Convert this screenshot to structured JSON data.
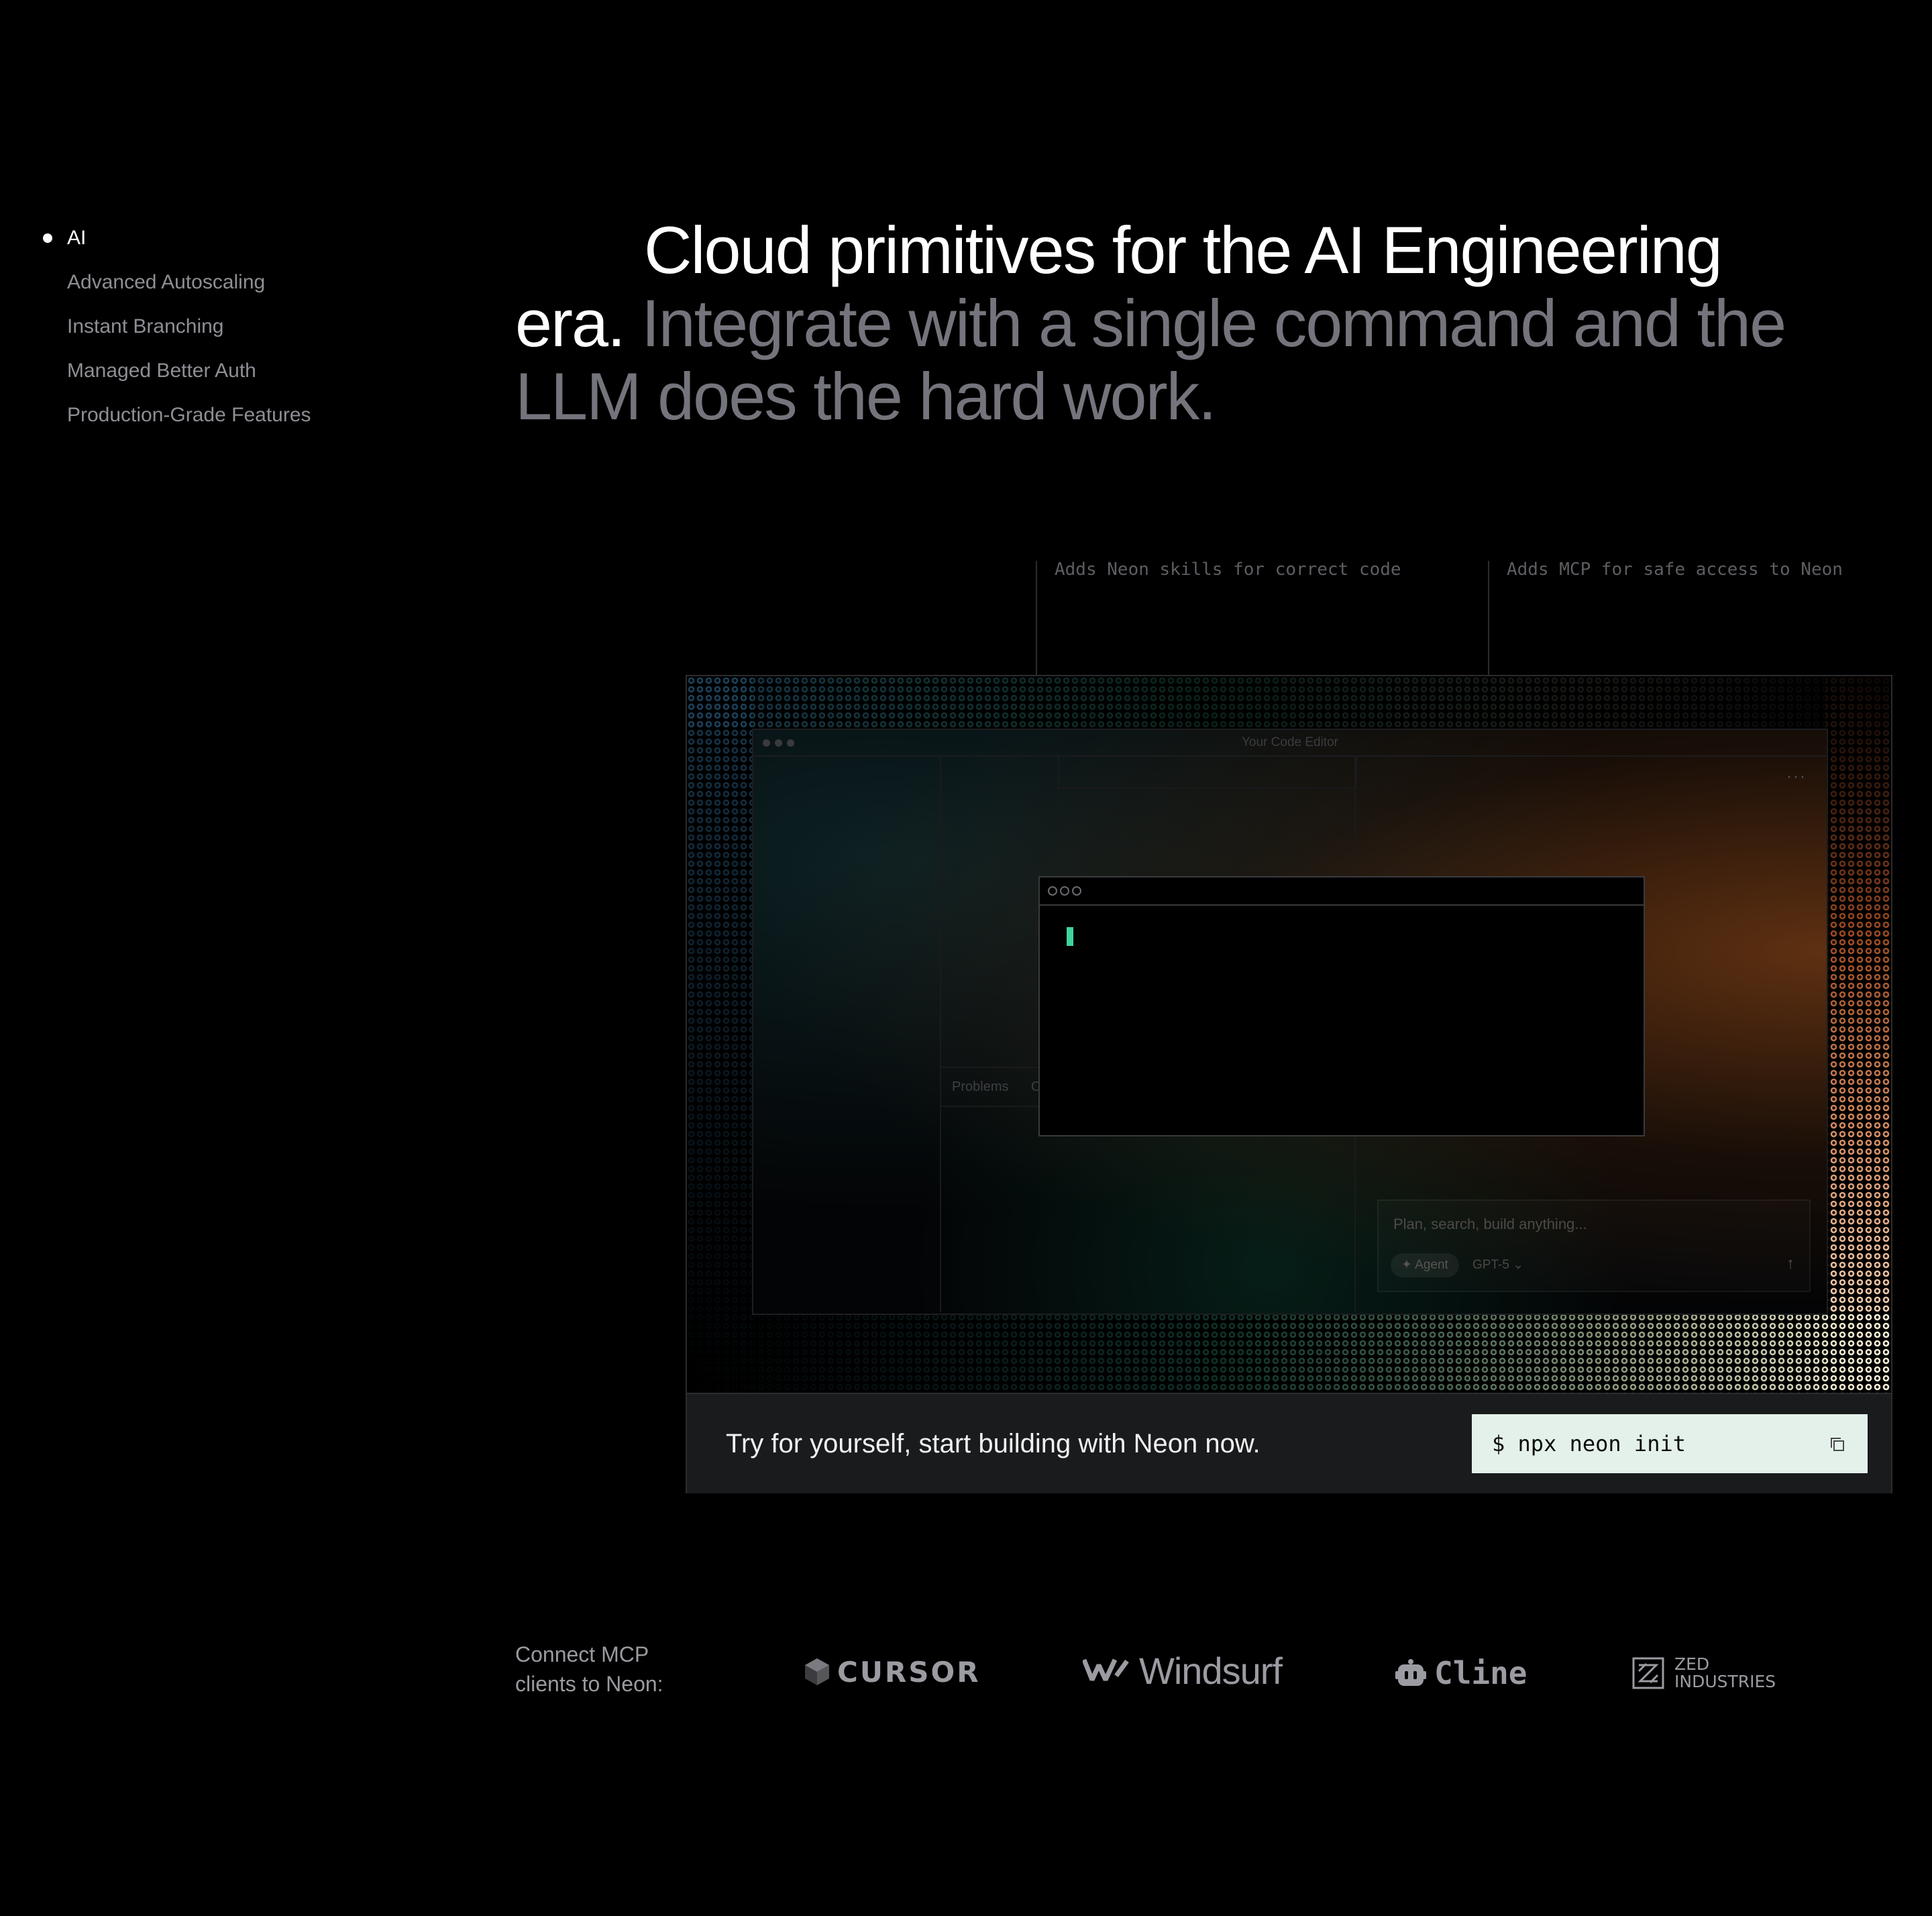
{
  "nav": {
    "items": [
      {
        "label": "AI",
        "active": true
      },
      {
        "label": "Advanced Autoscaling",
        "active": false
      },
      {
        "label": "Instant Branching",
        "active": false
      },
      {
        "label": "Managed Better Auth",
        "active": false
      },
      {
        "label": "Production-Grade Features",
        "active": false
      }
    ]
  },
  "headline": {
    "white": "Cloud primitives for the AI Engineering era.",
    "grey": "Integrate with a single command and the LLM does the hard work."
  },
  "annotations": {
    "skills": "Adds Neon skills for correct code",
    "mcp": "Adds MCP for safe access to Neon"
  },
  "editor": {
    "title": "Your Code Editor",
    "panel_tab_1": "Problems",
    "panel_tab_2": "O",
    "more": "···",
    "chat_placeholder": "Plan, search, build anything...",
    "chat_mode": "Agent",
    "chat_model": "GPT-5",
    "send_icon": "arrow-up-icon"
  },
  "cta": {
    "text": "Try for yourself, start building with Neon now.",
    "command": "$ npx neon init",
    "copy_icon": "copy-icon"
  },
  "connect": {
    "label_line1": "Connect MCP",
    "label_line2": "clients to Neon:",
    "logos": {
      "cursor": "CURSOR",
      "windsurf": "Windsurf",
      "cline": "Cline",
      "zed_line1": "ZED",
      "zed_line2": "INDUSTRIES"
    }
  },
  "colors": {
    "background": "#000000",
    "accent_green": "#3fd59a",
    "cta_bar": "#1a1b1d",
    "command_box": "#e4f1ea",
    "muted_text": "#74747c"
  }
}
